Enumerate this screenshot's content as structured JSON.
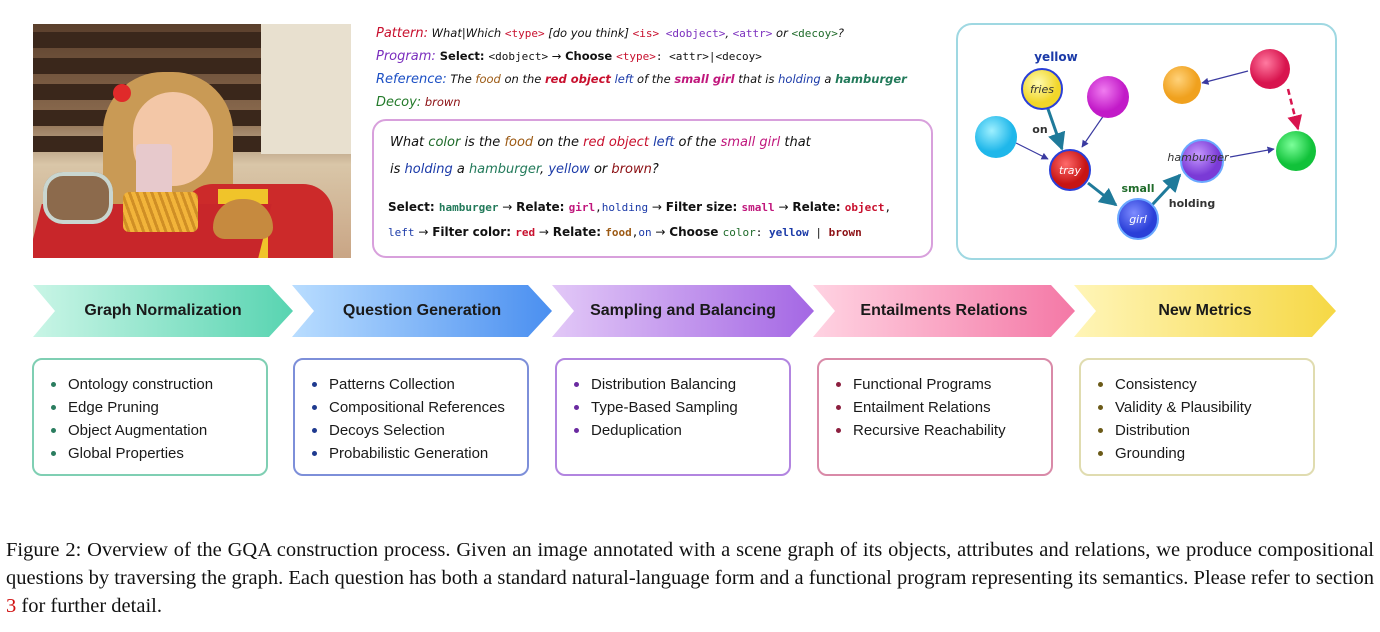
{
  "pattern": {
    "head": "Pattern:",
    "text": " What|Which ",
    "t1": "<type>",
    "t2": " [do you think] ",
    "t3": "<is>",
    "t4": " <dobject>",
    "t5": ", ",
    "t6": "<attr>",
    "t7": " or ",
    "t8": "<decoy>",
    "t9": "?"
  },
  "program": {
    "head": "Program:",
    "select": " Select: ",
    "dobj": "<dobject>",
    "arrow": " → ",
    "choose": "Choose ",
    "type": "<type>",
    "colon": ": ",
    "attr": "<attr>",
    "bar": "|",
    "decoy": "<decoy>"
  },
  "reference": {
    "head": "Reference:",
    "the1": " The ",
    "food": "food",
    "on": " on the ",
    "red_object": "red object",
    "sp": " ",
    "left": "left",
    "of": " of the ",
    "small_girl": "small girl",
    "that": " that is ",
    "holding": "holding",
    "a": " a ",
    "hamburger": "hamburger"
  },
  "decoy": {
    "head": "Decoy:",
    "value": " brown"
  },
  "question": {
    "l1_a": "What ",
    "l1_color": "color",
    "l1_b": " is the ",
    "l1_food": "food",
    "l1_c": " on the ",
    "l1_red": "red object",
    "l1_d": " ",
    "l1_left": "left",
    "l1_e": " of the ",
    "l1_small": "small girl",
    "l1_f": " that",
    "l2_a": "is ",
    "l2_holding": "holding",
    "l2_b": " a ",
    "l2_hamburger": "hamburger",
    "l2_c": ", ",
    "l2_yellow": "yellow",
    "l2_d": " or ",
    "l2_brown": "brown",
    "l2_e": "?"
  },
  "functional": {
    "select": "Select: ",
    "hamburger": "hamburger",
    "a1": " → ",
    "relate1": "Relate: ",
    "girl": "girl",
    "comma1": ",",
    "holding": "holding",
    "a2": " → ",
    "fsize": "Filter size: ",
    "small": "small",
    "a3": " → ",
    "relate2": "Relate: ",
    "object": "object",
    "comma2": ",",
    "left": "left",
    "a4": " → ",
    "fcolor": "Filter color: ",
    "red": "red",
    "a5": " → ",
    "relate3": "Relate: ",
    "food": "food",
    "comma3": ",",
    "on": "on",
    "a6": " → ",
    "choose": "Choose ",
    "color": "color",
    "colon": ": ",
    "yellow": "yellow",
    "bar": " | ",
    "brown": "brown"
  },
  "graph": {
    "nodes": {
      "fries": "fries",
      "tray": "tray",
      "girl": "girl",
      "hamburger": "hamburger"
    },
    "labels": {
      "yellow": "yellow",
      "on": "on",
      "small": "small",
      "holding": "holding"
    }
  },
  "stages": [
    {
      "label": "Graph Normalization",
      "color1": "#b6f0dc",
      "color2": "#5fd6b5"
    },
    {
      "label": "Question Generation",
      "color1": "#a9d4ff",
      "color2": "#4f8ff2"
    },
    {
      "label": "Sampling and Balancing",
      "color1": "#d9b8f5",
      "color2": "#a66ae6"
    },
    {
      "label": "Entailments Relations",
      "color1": "#ffc2d8",
      "color2": "#f27aa8"
    },
    {
      "label": "New Metrics",
      "color1": "#fff0a0",
      "color2": "#f7d94a"
    }
  ],
  "boxes": [
    {
      "border": "#7fcfb3",
      "dot": "#2a7d5f",
      "items": [
        "Ontology construction",
        "Edge Pruning",
        "Object Augmentation",
        "Global Properties"
      ]
    },
    {
      "border": "#7d8fd9",
      "dot": "#1f3a8f",
      "items": [
        "Patterns Collection",
        "Compositional References",
        "Decoys Selection",
        "Probabilistic Generation"
      ]
    },
    {
      "border": "#b285e0",
      "dot": "#6a2aa0",
      "items": [
        "Distribution Balancing",
        "Type-Based Sampling",
        "Deduplication"
      ]
    },
    {
      "border": "#d98aa8",
      "dot": "#8c1f3f",
      "items": [
        "Functional Programs",
        "Entailment Relations",
        "Recursive Reachability"
      ]
    },
    {
      "border": "#e0dcb0",
      "dot": "#6b5a18",
      "items": [
        "Consistency",
        "Validity & Plausibility",
        "Distribution",
        "Grounding"
      ]
    }
  ],
  "caption": {
    "text1": "Figure 2: Overview of the GQA construction process. Given an image annotated with a scene graph of its objects, attributes and relations, we produce compositional questions by traversing the graph. Each question has both a standard natural-language form and a functional program representing its semantics. Please refer to section ",
    "ref": "3",
    "text2": " for further detail."
  }
}
